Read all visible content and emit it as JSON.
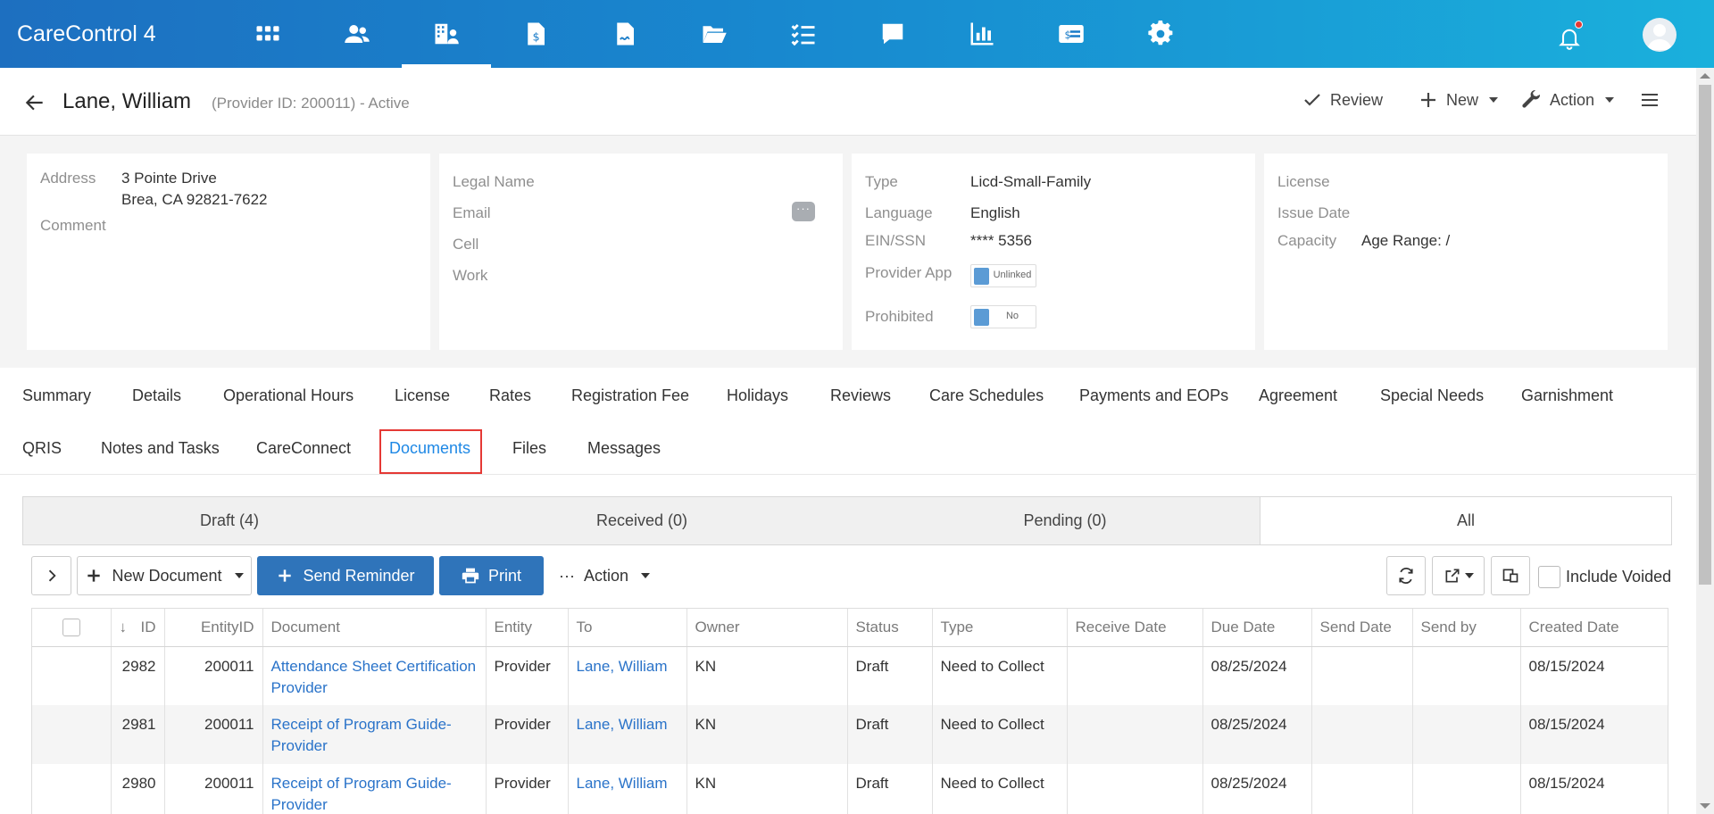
{
  "app": {
    "title": "CareControl 4"
  },
  "nav": {
    "icons": [
      "apps-grid-icon",
      "users-icon",
      "provider-building-icon",
      "invoice-dollar-icon",
      "signed-document-icon",
      "folder-open-icon",
      "task-list-icon",
      "chat-bubble-icon",
      "bar-chart-icon",
      "billing-card-icon",
      "settings-gear-icon"
    ],
    "active": "provider-building-icon"
  },
  "provider": {
    "name": "Lane, William",
    "meta": "(Provider ID: 200011) - Active"
  },
  "header_actions": {
    "review": "Review",
    "new": "New",
    "action": "Action"
  },
  "card1": {
    "address_label": "Address",
    "address_line1": "3 Pointe Drive",
    "address_line2": "Brea, CA 92821-7622",
    "comment_label": "Comment"
  },
  "card2": {
    "legal_name_label": "Legal Name",
    "email_label": "Email",
    "cell_label": "Cell",
    "work_label": "Work",
    "chat_glyph": "···"
  },
  "card3": {
    "type_label": "Type",
    "type_value": "Licd-Small-Family",
    "language_label": "Language",
    "language_value": "English",
    "ein_label": "EIN/SSN",
    "ein_value": "**** 5356",
    "provider_app_label": "Provider App",
    "provider_app_value": "Unlinked",
    "prohibited_label": "Prohibited",
    "prohibited_value": "No"
  },
  "card4": {
    "license_label": "License",
    "issue_date_label": "Issue Date",
    "capacity_label": "Capacity",
    "capacity_value": "Age Range: /"
  },
  "tabs": {
    "row1": [
      "Summary",
      "Details",
      "Operational Hours",
      "License",
      "Rates",
      "Registration Fee",
      "Holidays",
      "Reviews",
      "Care Schedules",
      "Payments and EOPs",
      "Agreement",
      "Special Needs",
      "Garnishment"
    ],
    "row2": [
      "QRIS",
      "Notes and Tasks",
      "CareConnect",
      "Documents",
      "Files",
      "Messages"
    ],
    "active": "Documents"
  },
  "subtabs": {
    "draft": "Draft (4)",
    "received": "Received (0)",
    "pending": "Pending (0)",
    "all": "All"
  },
  "toolbar": {
    "new_document": "New Document",
    "send_reminder": "Send Reminder",
    "print": "Print",
    "action": "Action",
    "action_dots": "···",
    "include_voided": "Include Voided"
  },
  "table": {
    "sort_glyph": "↓",
    "columns": [
      "ID",
      "EntityID",
      "Document",
      "Entity",
      "To",
      "Owner",
      "Status",
      "Type",
      "Receive Date",
      "Due Date",
      "Send Date",
      "Send by",
      "Created Date"
    ],
    "rows": [
      {
        "id": "2982",
        "entity_id": "200011",
        "document": "Attendance Sheet Certification Provider",
        "entity": "Provider",
        "to": "Lane, William",
        "owner": "KN",
        "status": "Draft",
        "type": "Need to Collect",
        "receive_date": "",
        "due_date": "08/25/2024",
        "send_date": "",
        "send_by": "",
        "created_date": "08/15/2024"
      },
      {
        "id": "2981",
        "entity_id": "200011",
        "document": "Receipt of Program Guide-Provider",
        "entity": "Provider",
        "to": "Lane, William",
        "owner": "KN",
        "status": "Draft",
        "type": "Need to Collect",
        "receive_date": "",
        "due_date": "08/25/2024",
        "send_date": "",
        "send_by": "",
        "created_date": "08/15/2024"
      },
      {
        "id": "2980",
        "entity_id": "200011",
        "document": "Receipt of Program Guide-Provider",
        "entity": "Provider",
        "to": "Lane, William",
        "owner": "KN",
        "status": "Draft",
        "type": "Need to Collect",
        "receive_date": "",
        "due_date": "08/25/2024",
        "send_date": "",
        "send_by": "",
        "created_date": "08/15/2024"
      }
    ]
  },
  "colors": {
    "accent": "#2f74ba",
    "link": "#2a73c9",
    "active_tab": "#1e88e5",
    "highlight": "#e53935",
    "nav_start": "#1d6fc0",
    "nav_end": "#1ab0dc"
  }
}
